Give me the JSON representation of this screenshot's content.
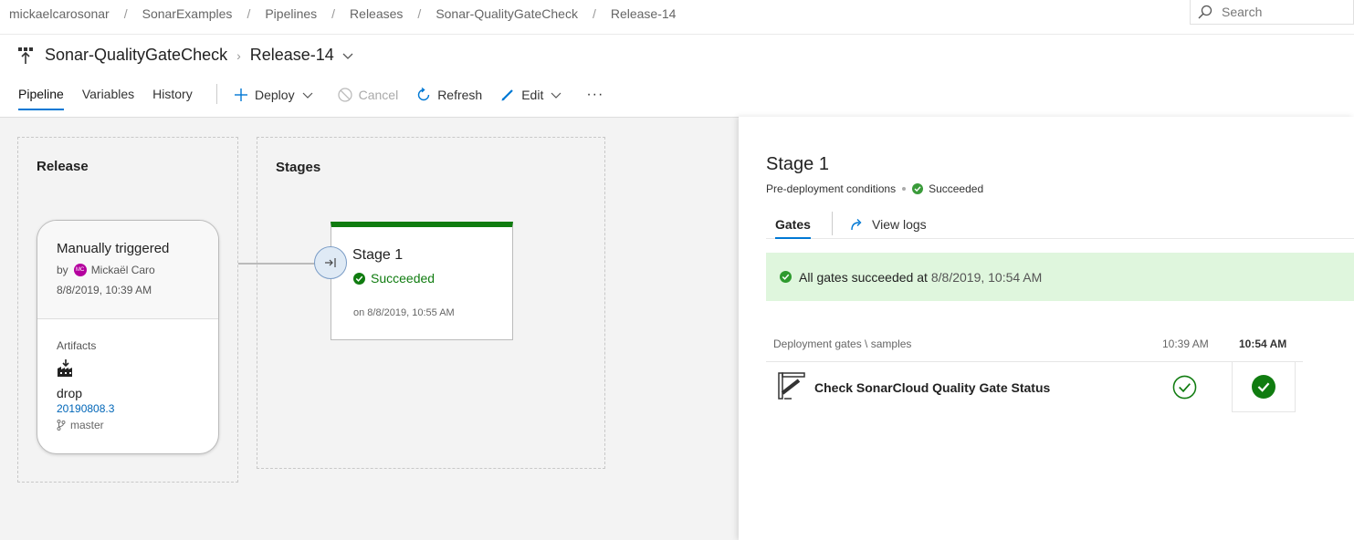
{
  "breadcrumb": [
    "mickaelcarosonar",
    "SonarExamples",
    "Pipelines",
    "Releases",
    "Sonar-QualityGateCheck",
    "Release-14"
  ],
  "search": {
    "placeholder": "Search"
  },
  "title": {
    "pipeline": "Sonar-QualityGateCheck",
    "release": "Release-14"
  },
  "tabs": [
    "Pipeline",
    "Variables",
    "History"
  ],
  "toolbar": {
    "deploy": "Deploy",
    "cancel": "Cancel",
    "refresh": "Refresh",
    "edit": "Edit",
    "more": "···"
  },
  "release_box": {
    "title": "Release",
    "trigger": "Manually triggered",
    "by": "by",
    "user_initials": "MC",
    "user": "Mickaël Caro",
    "date": "8/8/2019, 10:39 AM",
    "artifacts_label": "Artifacts",
    "artifact_name": "drop",
    "build": "20190808.3",
    "branch": "master"
  },
  "stages_box": {
    "title": "Stages",
    "stage_name": "Stage 1",
    "stage_status": "Succeeded",
    "stage_on": "on 8/8/2019, 10:55 AM"
  },
  "panel": {
    "title": "Stage 1",
    "subtitle": "Pre-deployment conditions",
    "status": "Succeeded",
    "tab_gates": "Gates",
    "tab_logs": "View logs",
    "banner_text": "All gates succeeded at",
    "banner_time": "8/8/2019, 10:54 AM",
    "gates_header": "Deployment gates \\ samples",
    "time1": "10:39 AM",
    "time2": "10:54 AM",
    "gate_name": "Check SonarCloud Quality Gate Status"
  },
  "colors": {
    "accent": "#0078d4",
    "success": "#107c10",
    "banner_bg": "#dff6dd"
  }
}
